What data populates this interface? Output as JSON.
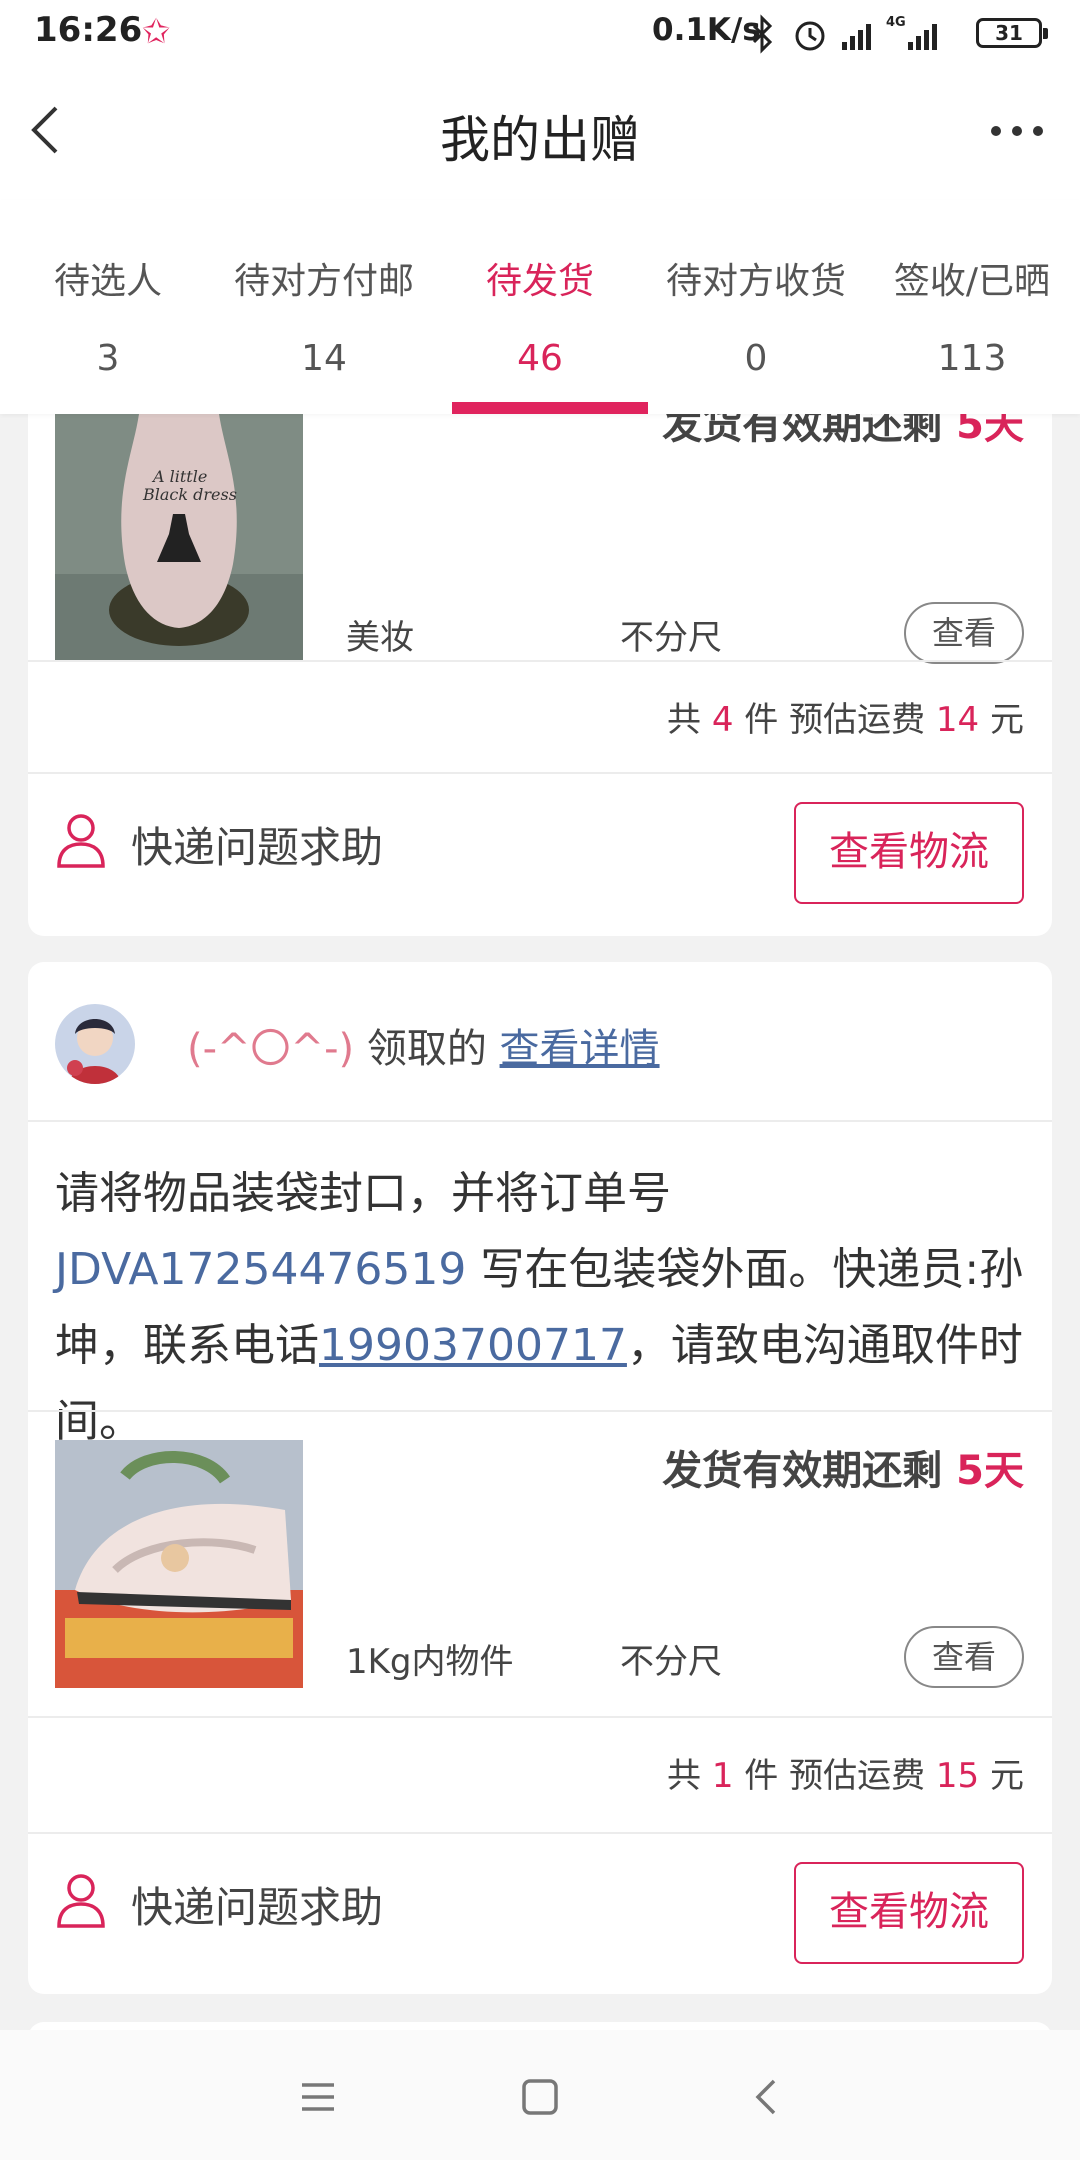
{
  "status_bar": {
    "time": "16:26",
    "network_speed": "0.1K/s",
    "network_type": "4G",
    "battery": "31"
  },
  "nav": {
    "title": "我的出赠"
  },
  "tabs": [
    {
      "label": "待选人",
      "count": "3"
    },
    {
      "label": "待对方付邮",
      "count": "14"
    },
    {
      "label": "待发货",
      "count": "46",
      "active": true
    },
    {
      "label": "待对方收货",
      "count": "0"
    },
    {
      "label": "签收/已晒",
      "count": "113"
    }
  ],
  "orders": [
    {
      "expiry_label": "发货有效期还剩",
      "expiry_days": "5天",
      "category": "美妆",
      "size": "不分尺",
      "view_label": "查看",
      "summary": {
        "prefix": "共",
        "count": "4",
        "mid": "件 预估运费",
        "fee": "14",
        "unit": "元"
      },
      "help_label": "快递问题求助",
      "logistics_label": "查看物流"
    },
    {
      "claimer_name": "(-^〇^-)",
      "claimed_suffix": "领取的",
      "details_link": "查看详情",
      "instruction": {
        "part1": "请将物品装袋封口，并将订单号 ",
        "order_no": "JDVA17254476519",
        "part2": " 写在包装袋外面。快递员:孙坤，联系电话",
        "phone": "19903700717",
        "part3": "，请致电沟通取件时间。"
      },
      "expiry_label": "发货有效期还剩",
      "expiry_days": "5天",
      "category": "1Kg内物件",
      "size": "不分尺",
      "view_label": "查看",
      "summary": {
        "prefix": "共",
        "count": "1",
        "mid": "件 预估运费",
        "fee": "15",
        "unit": "元"
      },
      "help_label": "快递问题求助",
      "logistics_label": "查看物流"
    }
  ],
  "colors": {
    "accent": "#d9245a",
    "link": "#4a6aa0"
  }
}
